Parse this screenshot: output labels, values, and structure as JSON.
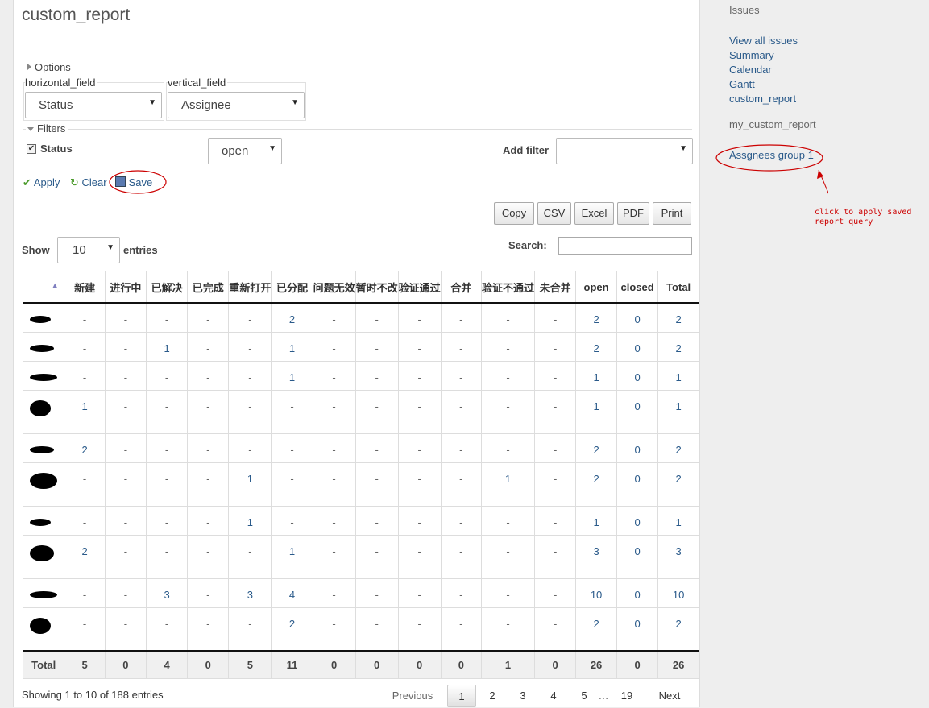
{
  "page": {
    "title": "custom_report",
    "options_legend": "Options",
    "horizontal_field_label": "horizontal_field",
    "horizontal_field_value": "Status",
    "vertical_field_label": "vertical_field",
    "vertical_field_value": "Assignee",
    "filters_legend": "Filters",
    "filter_status_label": "Status",
    "filter_status_value": "open",
    "add_filter_label": "Add filter",
    "apply_label": "Apply",
    "clear_label": "Clear",
    "save_label": "Save"
  },
  "export_buttons": [
    "Copy",
    "CSV",
    "Excel",
    "PDF",
    "Print"
  ],
  "table_controls": {
    "show_label": "Show",
    "entries_value": "10",
    "entries_label": "entries",
    "search_label": "Search:"
  },
  "table": {
    "headers": [
      "",
      "新建",
      "进行中",
      "已解决",
      "已完成",
      "重新打开",
      "已分配",
      "问题无效",
      "暂时不改",
      "验证通过",
      "合并",
      "验证不通过",
      "未合并",
      "open",
      "closed",
      "Total"
    ],
    "rows": [
      [
        "-",
        "-",
        "-",
        "-",
        "-",
        "2",
        "-",
        "-",
        "-",
        "-",
        "-",
        "-",
        "2",
        "0",
        "2"
      ],
      [
        "-",
        "-",
        "1",
        "-",
        "-",
        "1",
        "-",
        "-",
        "-",
        "-",
        "-",
        "-",
        "2",
        "0",
        "2"
      ],
      [
        "-",
        "-",
        "-",
        "-",
        "-",
        "1",
        "-",
        "-",
        "-",
        "-",
        "-",
        "-",
        "1",
        "0",
        "1"
      ],
      [
        "1",
        "-",
        "-",
        "-",
        "-",
        "-",
        "-",
        "-",
        "-",
        "-",
        "-",
        "-",
        "1",
        "0",
        "1"
      ],
      [
        "2",
        "-",
        "-",
        "-",
        "-",
        "-",
        "-",
        "-",
        "-",
        "-",
        "-",
        "-",
        "2",
        "0",
        "2"
      ],
      [
        "-",
        "-",
        "-",
        "-",
        "1",
        "-",
        "-",
        "-",
        "-",
        "-",
        "1",
        "-",
        "2",
        "0",
        "2"
      ],
      [
        "-",
        "-",
        "-",
        "-",
        "1",
        "-",
        "-",
        "-",
        "-",
        "-",
        "-",
        "-",
        "1",
        "0",
        "1"
      ],
      [
        "2",
        "-",
        "-",
        "-",
        "-",
        "1",
        "-",
        "-",
        "-",
        "-",
        "-",
        "-",
        "3",
        "0",
        "3"
      ],
      [
        "-",
        "-",
        "3",
        "-",
        "3",
        "4",
        "-",
        "-",
        "-",
        "-",
        "-",
        "-",
        "10",
        "0",
        "10"
      ],
      [
        "-",
        "-",
        "-",
        "-",
        "-",
        "2",
        "-",
        "-",
        "-",
        "-",
        "-",
        "-",
        "2",
        "0",
        "2"
      ]
    ],
    "totals_label": "Total",
    "totals": [
      "5",
      "0",
      "4",
      "0",
      "5",
      "11",
      "0",
      "0",
      "0",
      "0",
      "1",
      "0",
      "26",
      "0",
      "26"
    ]
  },
  "footer": {
    "info": "Showing 1 to 10 of 188 entries",
    "previous": "Previous",
    "pages": [
      "1",
      "2",
      "3",
      "4",
      "5"
    ],
    "ellipsis": "…",
    "last_page": "19",
    "next": "Next"
  },
  "sidebar": {
    "title": "Issues",
    "links": [
      "View all issues",
      "Summary",
      "Calendar",
      "Gantt",
      "custom_report"
    ],
    "saved_title": "my_custom_report",
    "saved_query": "Assgnees group 1",
    "annotation_line1": "click to apply saved",
    "annotation_line2": "report query"
  },
  "colors": {
    "link": "#2a5a8a",
    "annotation": "#cc0000",
    "apply_icon": "#4a9a2a"
  }
}
